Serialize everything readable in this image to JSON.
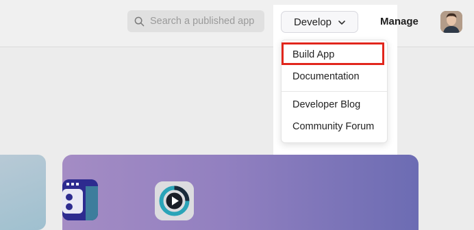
{
  "header": {
    "search": {
      "placeholder": "Search a published app",
      "icon": "search-icon"
    },
    "develop_button": {
      "label": "Develop",
      "icon": "chevron-down-icon"
    },
    "manage_label": "Manage",
    "avatar": "user-avatar"
  },
  "develop_menu": {
    "items": [
      {
        "label": "Build App",
        "highlighted": true
      },
      {
        "label": "Documentation"
      },
      {
        "label": "Developer Blog"
      },
      {
        "label": "Community Forum"
      }
    ]
  },
  "colors": {
    "highlight_border": "#e1261c",
    "banner_start": "#a48cc4",
    "banner_end": "#6c6cb3"
  }
}
